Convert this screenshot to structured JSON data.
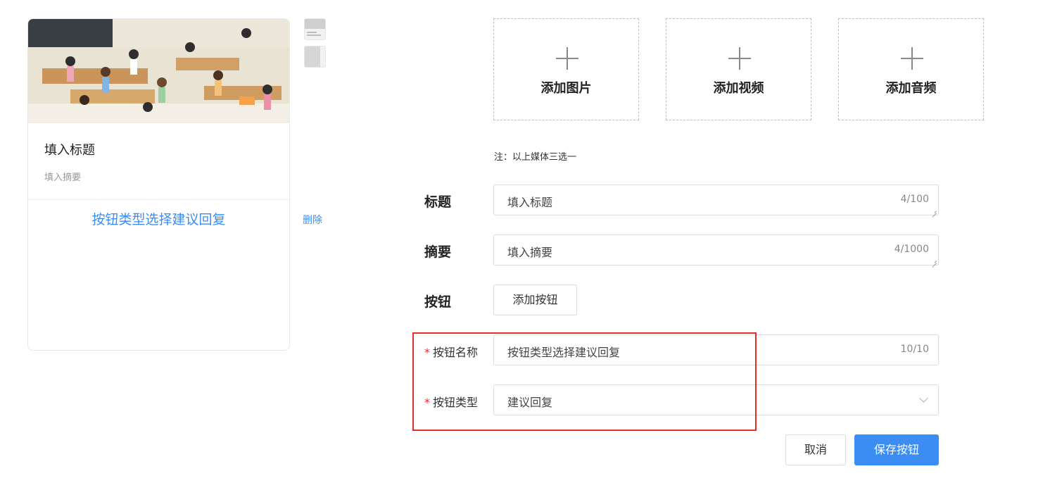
{
  "preview": {
    "title": "填入标题",
    "summary": "填入摘要",
    "button_label": "按钮类型选择建议回复",
    "delete_label": "删除"
  },
  "media": {
    "add_image": "添加图片",
    "add_video": "添加视频",
    "add_audio": "添加音频",
    "note": "注：以上媒体三选一"
  },
  "form": {
    "title_label": "标题",
    "title_value": "填入标题",
    "title_count": "4/100",
    "summary_label": "摘要",
    "summary_value": "填入摘要",
    "summary_count": "4/1000",
    "button_label": "按钮",
    "add_button": "添加按钮",
    "button_name_label": "按钮名称",
    "button_name_value": "按钮类型选择建议回复",
    "button_name_count": "10/10",
    "button_type_label": "按钮类型",
    "button_type_value": "建议回复",
    "required_mark": "*",
    "cancel": "取消",
    "save": "保存按钮"
  },
  "colors": {
    "accent": "#3b8cf3",
    "required": "#f5222d",
    "highlight": "#e0322c"
  }
}
